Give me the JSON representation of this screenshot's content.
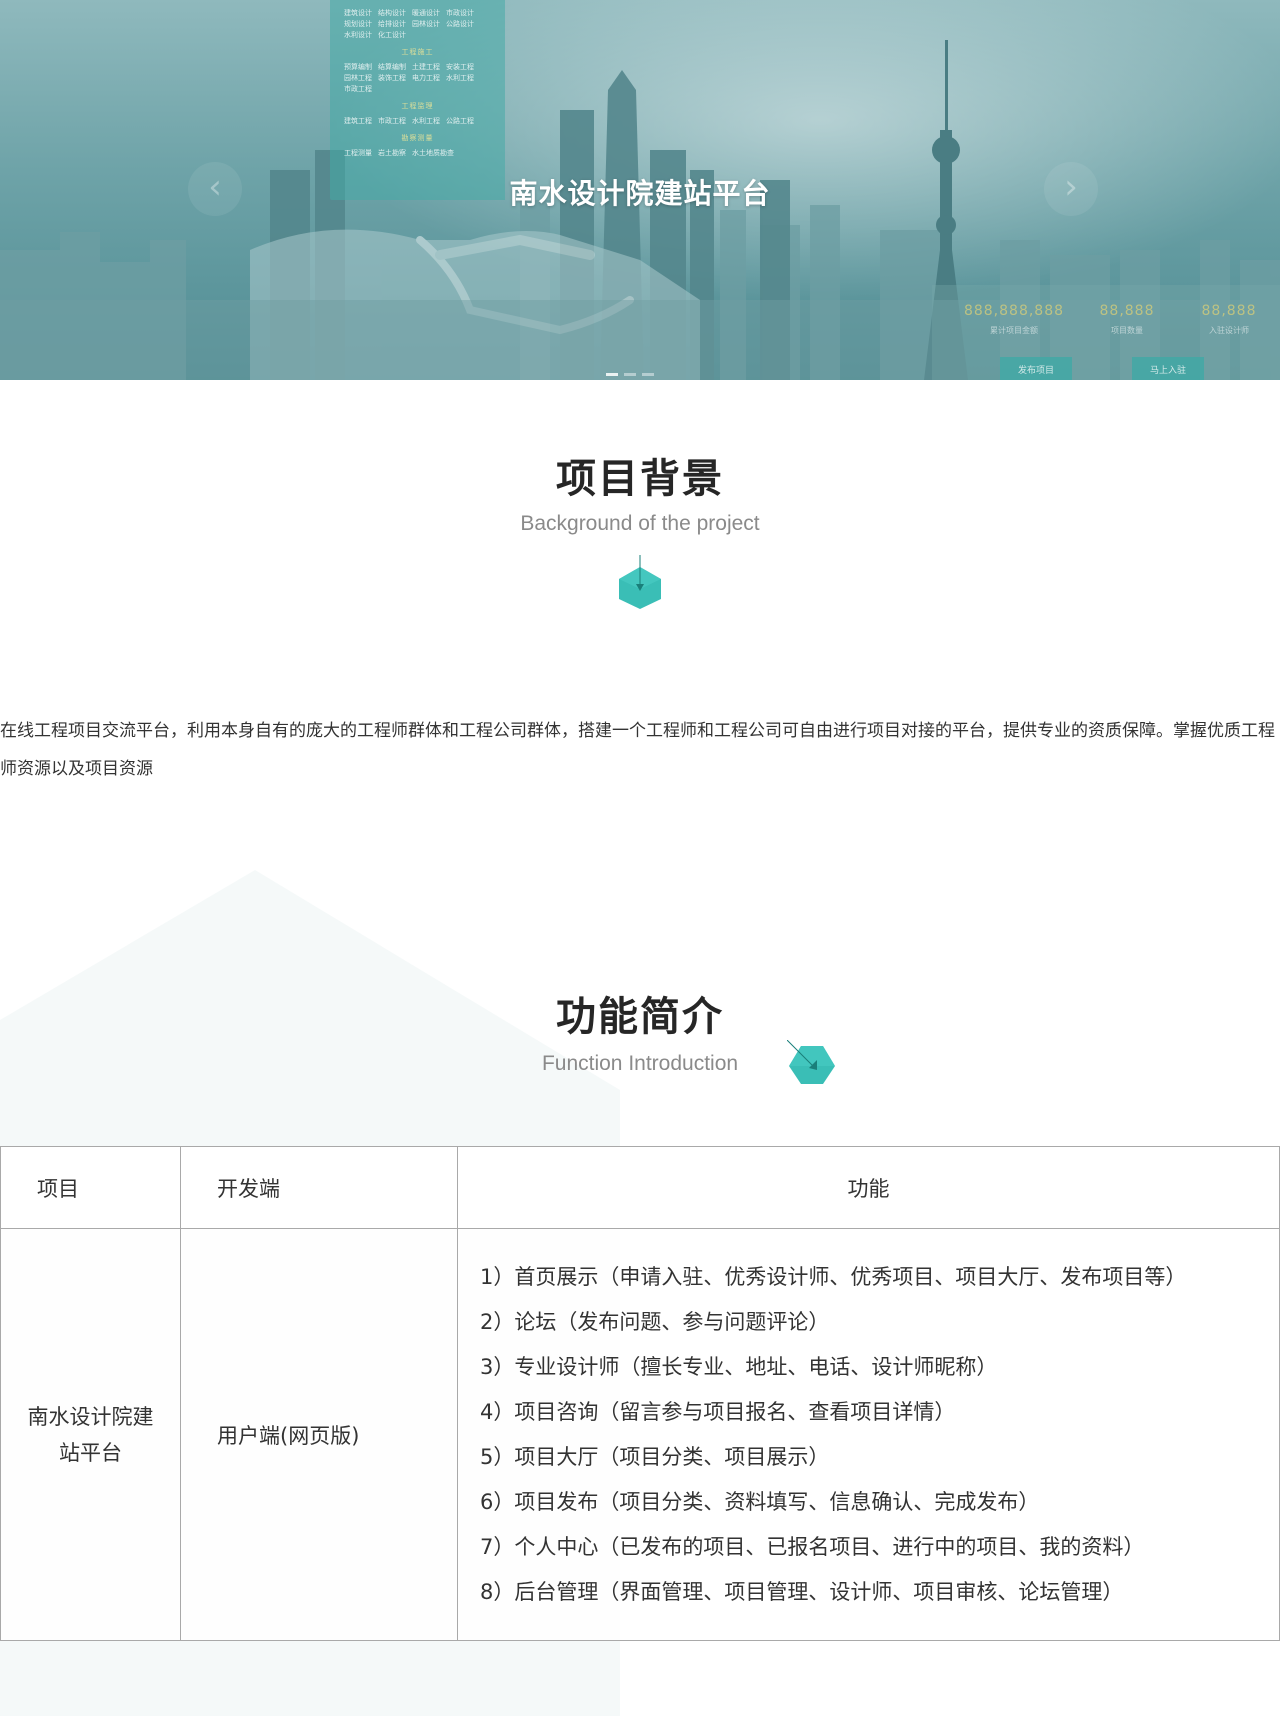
{
  "hero": {
    "title": "南水设计院建站平台",
    "prev_arrow": "‹",
    "next_arrow": "›",
    "menu_rows_1": [
      "建筑设计",
      "结构设计",
      "暖通设计",
      "市政设计"
    ],
    "menu_rows_2": [
      "规划设计",
      "给排设计",
      "园林设计",
      "公路设计"
    ],
    "menu_rows_3": [
      "水利设计",
      "化工设计"
    ],
    "menu_sec_1": "工程施工",
    "menu_rows_4": [
      "预算编制",
      "结算编制",
      "土建工程",
      "安装工程"
    ],
    "menu_rows_5": [
      "园林工程",
      "装饰工程",
      "电力工程",
      "水利工程"
    ],
    "menu_rows_6": [
      "市政工程"
    ],
    "menu_sec_2": "工程监理",
    "menu_rows_7": [
      "建筑工程",
      "市政工程",
      "水利工程",
      "公路工程"
    ],
    "menu_sec_3": "勘察测量",
    "menu_rows_8": [
      "工程测量",
      "岩土勘察",
      "水土地质勘查"
    ],
    "stats": [
      {
        "value": "888,888,888",
        "label": "累计项目金额"
      },
      {
        "value": "88,888",
        "label": "项目数量"
      },
      {
        "value": "88,888",
        "label": "入驻设计师"
      }
    ],
    "publish_btn": "发布项目",
    "join_btn": "马上入驻"
  },
  "background": {
    "title": "项目背景",
    "subtitle": "Background of the project",
    "text": "在线工程项目交流平台，利用本身自有的庞大的工程师群体和工程公司群体，搭建一个工程师和工程公司可自由进行项目对接的平台，提供专业的资质保障。掌握优质工程师资源以及项目资源"
  },
  "functions": {
    "title": "功能简介",
    "subtitle": "Function Introduction",
    "headers": {
      "project": "项目",
      "platform": "开发端",
      "features": "功能"
    },
    "row": {
      "project": "南水设计院建站平台",
      "platform": "用户端(网页版)",
      "features": [
        "1）首页展示（申请入驻、优秀设计师、优秀项目、项目大厅、发布项目等）",
        "2）论坛（发布问题、参与问题评论）",
        "3）专业设计师（擅长专业、地址、电话、设计师昵称）",
        "4）项目咨询（留言参与项目报名、查看项目详情）",
        "5）项目大厅（项目分类、项目展示）",
        "6）项目发布（项目分类、资料填写、信息确认、完成发布）",
        "7）个人中心（已发布的项目、已报名项目、进行中的项目、我的资料）",
        "8）后台管理（界面管理、项目管理、设计师、项目审核、论坛管理）"
      ]
    }
  },
  "colors": {
    "accent": "#2fbab2",
    "accent_dark": "#1f9f98",
    "text": "#333333",
    "muted": "#8a8a8a"
  }
}
